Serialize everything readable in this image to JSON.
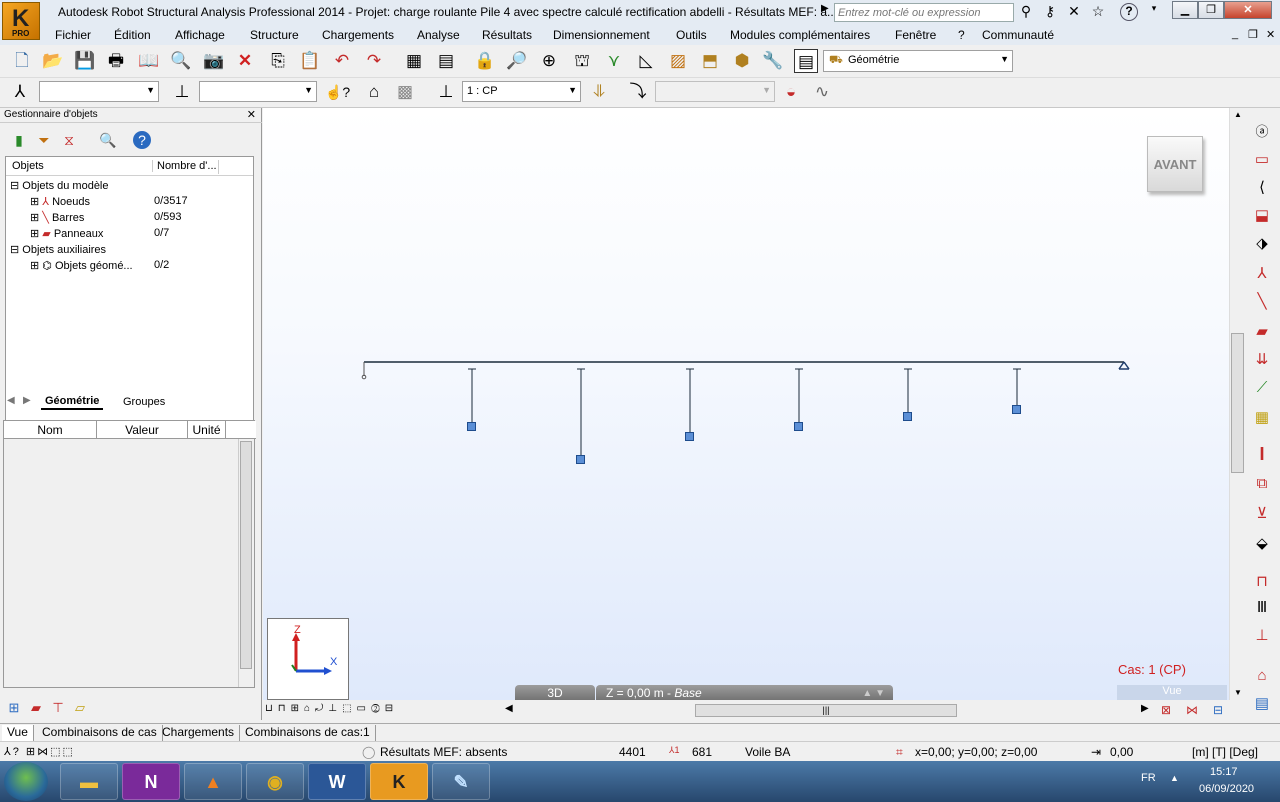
{
  "titlebar": {
    "title": "Autodesk Robot Structural Analysis Professional 2014 - Projet: charge roulante Pile 4 avec spectre calculé rectification abdelli - Résultats MEF: a...",
    "logo_text": "PRO",
    "search_placeholder": "Entrez mot-clé ou expression",
    "help_label": "?"
  },
  "menubar": {
    "items": [
      "Fichier",
      "Édition",
      "Affichage",
      "Structure",
      "Chargements",
      "Analyse",
      "Résultats",
      "Dimensionnement",
      "Outils",
      "Modules complémentaires",
      "Fenêtre",
      "?",
      "Communauté"
    ]
  },
  "toolbar1": {
    "layout_combo": "Géométrie"
  },
  "toolbar2": {
    "combo1": "",
    "combo2": "",
    "case_combo": "1 : CP",
    "combo4": ""
  },
  "object_manager": {
    "title": "Gestionnaire d'objets",
    "col_objects": "Objets",
    "col_count": "Nombre d'...",
    "tree": [
      {
        "label": "Objets du modèle",
        "count": ""
      },
      {
        "label": "Noeuds",
        "count": "0/3517"
      },
      {
        "label": "Barres",
        "count": "0/593"
      },
      {
        "label": "Panneaux",
        "count": "0/7"
      },
      {
        "label": "Objets auxiliaires",
        "count": ""
      },
      {
        "label": "Objets géomé...",
        "count": "0/2"
      }
    ],
    "tab_geometry": "Géométrie",
    "tab_groups": "Groupes"
  },
  "properties": {
    "col_name": "Nom",
    "col_value": "Valeur",
    "col_unit": "Unité"
  },
  "viewport": {
    "view_cube_label": "AVANT",
    "case_label": "Cas: 1 (CP)",
    "btn_3d": "3D",
    "z_level": "Z = 0,00 m - ",
    "z_level_name": "Base",
    "vue_button": "Vue",
    "axis_z": "Z",
    "axis_x": "X"
  },
  "view_tabs": [
    "Vue",
    "Combinaisons de cas",
    "Chargements",
    "Combinaisons de cas:1"
  ],
  "status": {
    "results": "Résultats MEF: absents",
    "nodes": "4401",
    "bars": "681",
    "section": "Voile BA",
    "coords": "x=0,00; y=0,00; z=0,00",
    "angle": "0,00",
    "units": "[m] [T] [Deg]"
  },
  "taskbar": {
    "language": "FR",
    "time": "15:17",
    "date": "06/09/2020"
  }
}
